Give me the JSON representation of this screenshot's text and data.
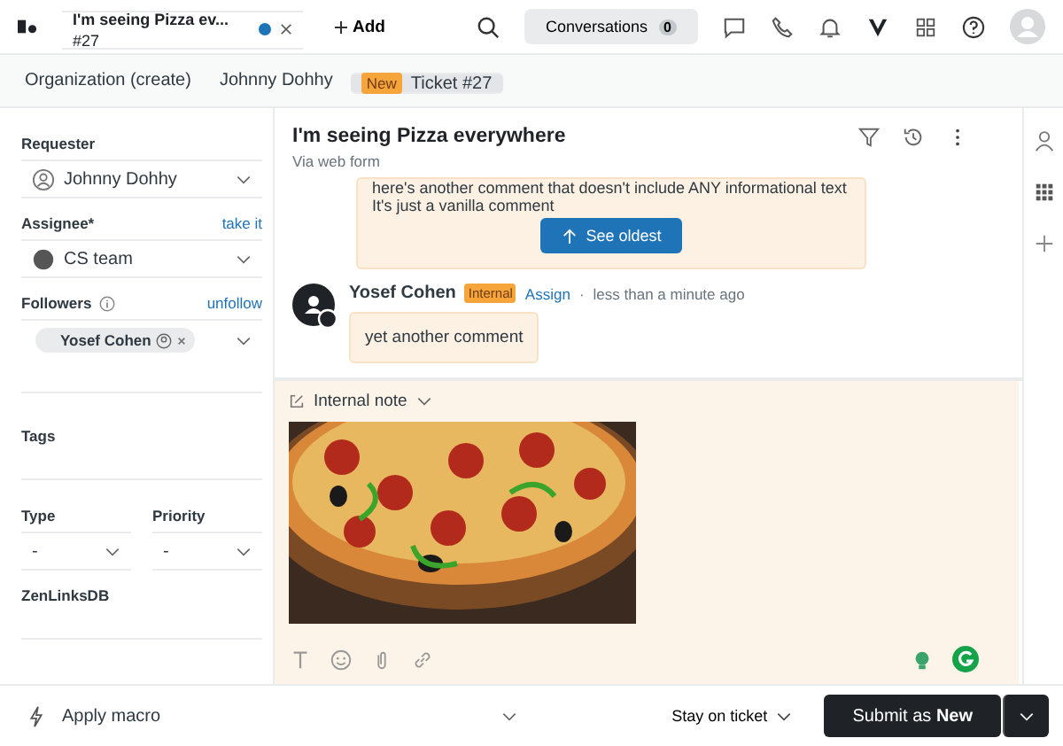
{
  "top_bar": {
    "tabs": [
      {
        "title": "I'm seeing Pizza ev...",
        "number": "#27",
        "selected": true,
        "unsaved": true
      }
    ],
    "add_label": "Add",
    "conversations": {
      "label": "Conversations",
      "count": "0"
    }
  },
  "breadcrumbs": [
    {
      "label": "Organization (create)",
      "selected": false
    },
    {
      "label": "Johnny Dohhy",
      "selected": false
    },
    {
      "badge": "New",
      "label": "Ticket #27",
      "selected": true
    }
  ],
  "sidebar": {
    "requester": {
      "label": "Requester",
      "value": "Johnny Dohhy"
    },
    "assignee": {
      "label": "Assignee*",
      "action": "take it",
      "value": "CS team"
    },
    "followers": {
      "label": "Followers",
      "action": "unfollow",
      "chips": [
        "Yosef Cohen"
      ]
    },
    "tags": {
      "label": "Tags"
    },
    "type": {
      "label": "Type",
      "value": "-"
    },
    "priority": {
      "label": "Priority",
      "value": "-"
    },
    "zenlinks": {
      "label": "ZenLinksDB"
    }
  },
  "ticket": {
    "title": "I'm seeing Pizza everywhere",
    "via": "Via web form"
  },
  "earlier_comment": {
    "lines": [
      "here's another comment that doesn't include ANY informational text",
      "It's just a vanilla comment"
    ],
    "see_oldest": "See oldest"
  },
  "comment": {
    "author": "Yosef Cohen",
    "badge": "Internal",
    "action": "Assign",
    "separator": "·",
    "time": "less than a minute ago",
    "body": "yet another comment"
  },
  "composer": {
    "mode": "Internal note"
  },
  "footer": {
    "macro": "Apply macro",
    "stay": "Stay on ticket",
    "submit": "Submit as **New**"
  }
}
